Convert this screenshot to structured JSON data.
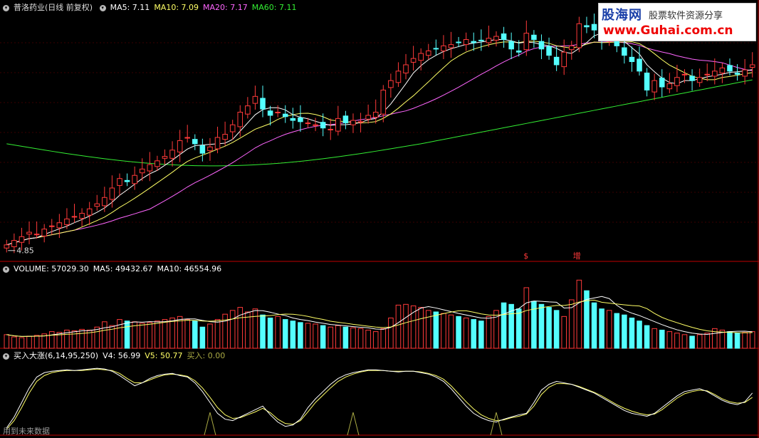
{
  "header": {
    "stock_name": "普洛药业(日线 前复权)",
    "ma5": "MA5: 7.11",
    "ma10": "MA10: 7.09",
    "ma20": "MA20: 7.17",
    "ma60": "MA60: 7.11"
  },
  "volume_header": {
    "volume": "VOLUME: 57029.30",
    "ma5": "MA5: 49432.67",
    "ma10": "MA10: 46554.96"
  },
  "indicator_header": {
    "name": "买入大涨(6,14,95,250)",
    "v4": "V4: 56.99",
    "v5": "V5: 50.77",
    "buy": "买入: 0.00"
  },
  "footer_note": "用到未来数据",
  "low_price_label": "4.85",
  "markers": [
    "$",
    "增"
  ],
  "logo": {
    "brand": "股海网",
    "slogan": "股票软件资源分享",
    "url": "www.Guhai.com.cn"
  },
  "colors": {
    "up": "#ff3a3a",
    "down": "#54ffff",
    "ma5": "#ffffff",
    "ma10": "#ffff66",
    "ma20": "#ff66ff",
    "ma60": "#33ee33",
    "v4": "#ffffff",
    "v5": "#ffff66",
    "buy": "#aaaa44"
  },
  "chart_data": {
    "type": "candlestick",
    "ylim": [
      4.6,
      8.5
    ],
    "close": [
      4.85,
      4.92,
      4.98,
      5.05,
      5.02,
      5.1,
      5.15,
      5.2,
      5.26,
      5.3,
      5.35,
      5.42,
      5.5,
      5.6,
      5.75,
      5.9,
      5.85,
      5.95,
      6.05,
      6.12,
      6.18,
      6.25,
      6.35,
      6.5,
      6.55,
      6.45,
      6.3,
      6.4,
      6.55,
      6.6,
      6.75,
      6.95,
      7.05,
      7.2,
      7.0,
      6.9,
      6.95,
      6.88,
      6.82,
      6.8,
      6.78,
      6.75,
      6.7,
      6.68,
      6.85,
      6.78,
      6.82,
      6.8,
      6.9,
      6.95,
      7.3,
      7.45,
      7.6,
      7.7,
      7.8,
      7.88,
      7.92,
      7.95,
      8.0,
      8.02,
      8.05,
      8.1,
      8.05,
      8.08,
      8.12,
      8.15,
      8.1,
      7.95,
      7.9,
      8.2,
      8.1,
      7.95,
      7.85,
      7.7,
      7.9,
      8.0,
      8.35,
      8.3,
      8.25,
      8.1,
      8.15,
      8.0,
      7.85,
      7.75,
      7.6,
      7.3,
      7.45,
      7.35,
      7.4,
      7.5,
      7.55,
      7.45,
      7.5,
      7.55,
      7.6,
      7.65,
      7.6,
      7.55,
      7.62,
      7.7
    ],
    "volume": [
      18000,
      15000,
      14000,
      16000,
      17000,
      19000,
      22000,
      21000,
      24000,
      23000,
      25000,
      24000,
      28000,
      35000,
      30000,
      38000,
      36000,
      35000,
      33000,
      34000,
      36000,
      38000,
      40000,
      42000,
      38000,
      36000,
      28000,
      32000,
      38000,
      45000,
      50000,
      54000,
      48000,
      52000,
      44000,
      40000,
      42000,
      38000,
      36000,
      34000,
      33000,
      32000,
      30000,
      28000,
      30000,
      28000,
      27000,
      26000,
      24000,
      22000,
      26000,
      40000,
      57000,
      58000,
      56000,
      54000,
      50000,
      48000,
      46000,
      44000,
      42000,
      40000,
      38000,
      36000,
      42000,
      50000,
      60000,
      58000,
      52000,
      80000,
      62000,
      58000,
      54000,
      50000,
      42000,
      64000,
      90000,
      76000,
      60000,
      52000,
      50000,
      46000,
      44000,
      40000,
      36000,
      30000,
      26000,
      24000,
      22000,
      20000,
      18000,
      16000,
      18000,
      20000,
      26000,
      24000,
      22000,
      20000,
      21000,
      22000
    ],
    "v4": [
      10,
      25,
      45,
      65,
      80,
      86,
      88,
      89,
      90,
      89,
      90,
      91,
      92,
      91,
      88,
      82,
      75,
      68,
      72,
      78,
      82,
      84,
      85,
      82,
      80,
      72,
      60,
      45,
      30,
      22,
      20,
      25,
      30,
      35,
      40,
      28,
      18,
      12,
      14,
      22,
      38,
      50,
      60,
      70,
      78,
      83,
      86,
      88,
      90,
      90,
      89,
      88,
      87,
      88,
      88,
      86,
      84,
      80,
      74,
      64,
      52,
      40,
      30,
      24,
      20,
      18,
      22,
      25,
      28,
      30,
      45,
      62,
      70,
      74,
      72,
      70,
      66,
      62,
      58,
      52,
      46,
      40,
      34,
      30,
      28,
      26,
      30,
      38,
      46,
      54,
      60,
      62,
      64,
      60,
      54,
      48,
      44,
      42,
      46,
      58
    ],
    "v5": [
      8,
      20,
      38,
      58,
      74,
      82,
      86,
      88,
      89,
      89,
      89,
      90,
      91,
      90,
      89,
      85,
      78,
      72,
      72,
      76,
      80,
      83,
      84,
      83,
      81,
      75,
      65,
      52,
      38,
      28,
      23,
      24,
      28,
      32,
      37,
      31,
      22,
      16,
      15,
      20,
      32,
      45,
      55,
      65,
      74,
      80,
      84,
      87,
      89,
      89,
      89,
      88,
      88,
      88,
      88,
      87,
      85,
      82,
      77,
      68,
      57,
      46,
      36,
      28,
      23,
      20,
      21,
      24,
      26,
      29,
      40,
      56,
      66,
      71,
      71,
      70,
      67,
      63,
      59,
      54,
      48,
      42,
      37,
      33,
      30,
      28,
      29,
      35,
      43,
      51,
      57,
      60,
      62,
      61,
      56,
      50,
      46,
      44,
      45,
      52
    ],
    "buy_signals": [
      27,
      46,
      65
    ]
  }
}
